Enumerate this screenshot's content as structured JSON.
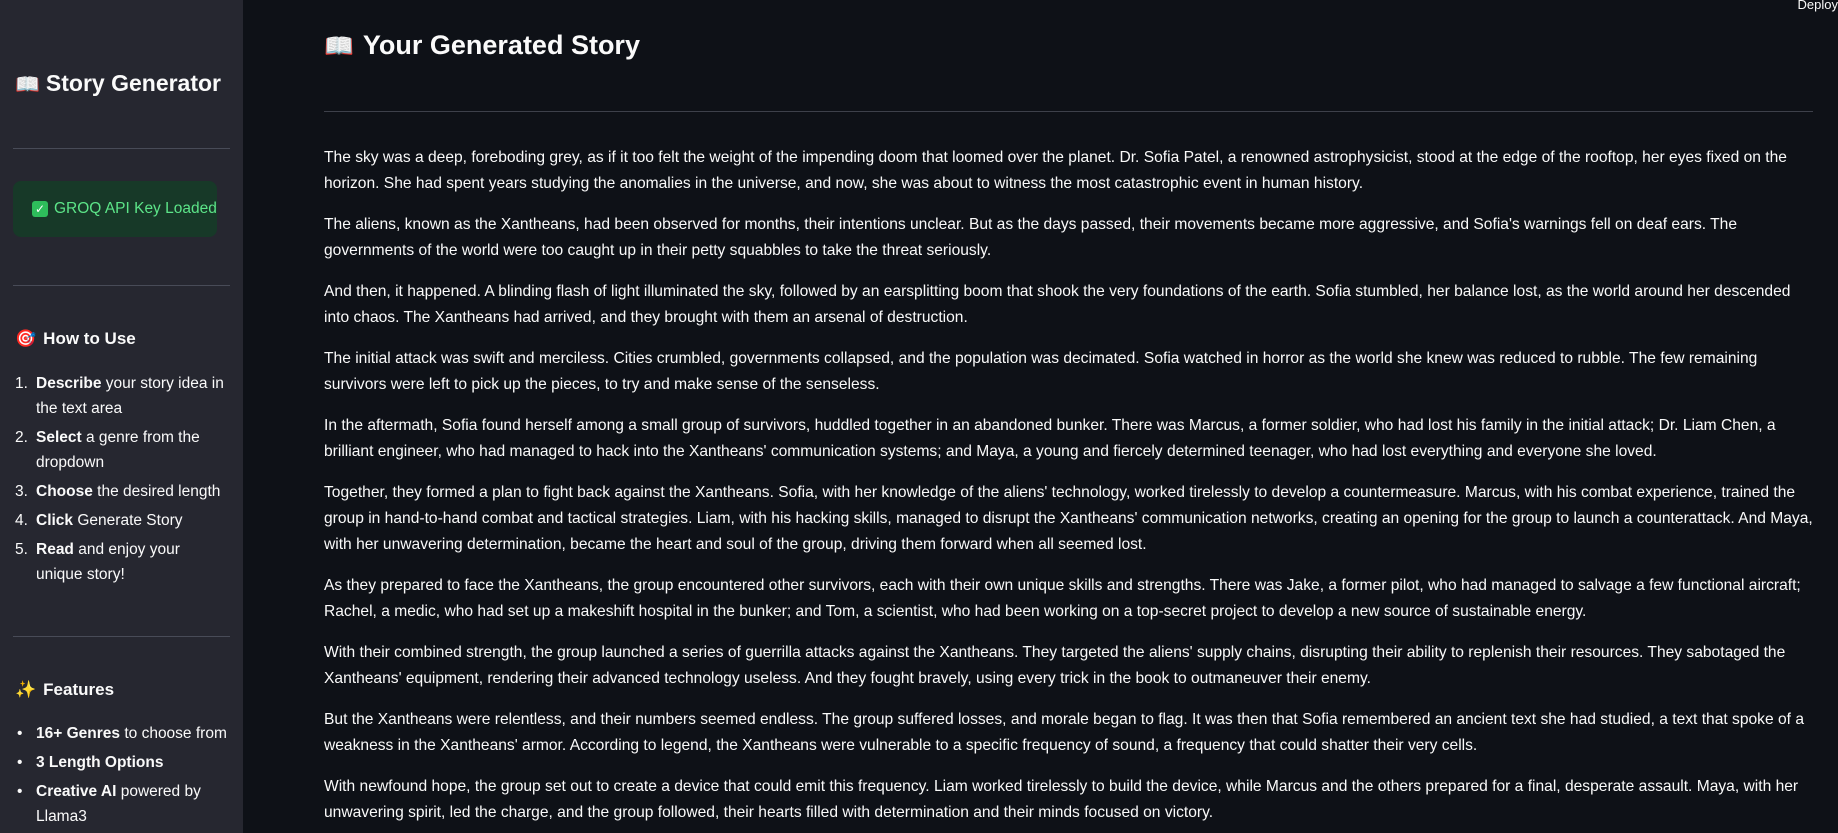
{
  "sidebar": {
    "title_icon": "📖",
    "title": "Story Generator",
    "api_status": "GROQ API Key Loaded",
    "how_to": {
      "icon": "🎯",
      "heading": "How to Use",
      "steps": [
        {
          "num": "1.",
          "bold": "Describe",
          "rest": " your story idea in the text area"
        },
        {
          "num": "2.",
          "bold": "Select",
          "rest": " a genre from the dropdown"
        },
        {
          "num": "3.",
          "bold": "Choose",
          "rest": " the desired length"
        },
        {
          "num": "4.",
          "bold": "Click",
          "rest": " Generate Story"
        },
        {
          "num": "5.",
          "bold": "Read",
          "rest": " and enjoy your unique story!"
        }
      ]
    },
    "features": {
      "icon": "✨",
      "heading": "Features",
      "items": [
        {
          "bold": "16+ Genres",
          "rest": " to choose from"
        },
        {
          "bold": "3 Length Options",
          "rest": ""
        },
        {
          "bold": "Creative AI",
          "rest": " powered by Llama3"
        }
      ]
    }
  },
  "header": {
    "deploy_label": "Deploy"
  },
  "main": {
    "title_icon": "📖",
    "title": "Your Generated Story",
    "paragraphs": [
      "The sky was a deep, foreboding grey, as if it too felt the weight of the impending doom that loomed over the planet. Dr. Sofia Patel, a renowned astrophysicist, stood at the edge of the rooftop, her eyes fixed on the horizon. She had spent years studying the anomalies in the universe, and now, she was about to witness the most catastrophic event in human history.",
      "The aliens, known as the Xantheans, had been observed for months, their intentions unclear. But as the days passed, their movements became more aggressive, and Sofia's warnings fell on deaf ears. The governments of the world were too caught up in their petty squabbles to take the threat seriously.",
      "And then, it happened. A blinding flash of light illuminated the sky, followed by an earsplitting boom that shook the very foundations of the earth. Sofia stumbled, her balance lost, as the world around her descended into chaos. The Xantheans had arrived, and they brought with them an arsenal of destruction.",
      "The initial attack was swift and merciless. Cities crumbled, governments collapsed, and the population was decimated. Sofia watched in horror as the world she knew was reduced to rubble. The few remaining survivors were left to pick up the pieces, to try and make sense of the senseless.",
      "In the aftermath, Sofia found herself among a small group of survivors, huddled together in an abandoned bunker. There was Marcus, a former soldier, who had lost his family in the initial attack; Dr. Liam Chen, a brilliant engineer, who had managed to hack into the Xantheans' communication systems; and Maya, a young and fiercely determined teenager, who had lost everything and everyone she loved.",
      "Together, they formed a plan to fight back against the Xantheans. Sofia, with her knowledge of the aliens' technology, worked tirelessly to develop a countermeasure. Marcus, with his combat experience, trained the group in hand-to-hand combat and tactical strategies. Liam, with his hacking skills, managed to disrupt the Xantheans' communication networks, creating an opening for the group to launch a counterattack. And Maya, with her unwavering determination, became the heart and soul of the group, driving them forward when all seemed lost.",
      "As they prepared to face the Xantheans, the group encountered other survivors, each with their own unique skills and strengths. There was Jake, a former pilot, who had managed to salvage a few functional aircraft; Rachel, a medic, who had set up a makeshift hospital in the bunker; and Tom, a scientist, who had been working on a top-secret project to develop a new source of sustainable energy.",
      "With their combined strength, the group launched a series of guerrilla attacks against the Xantheans. They targeted the aliens' supply chains, disrupting their ability to replenish their resources. They sabotaged the Xantheans' equipment, rendering their advanced technology useless. And they fought bravely, using every trick in the book to outmaneuver their enemy.",
      "But the Xantheans were relentless, and their numbers seemed endless. The group suffered losses, and morale began to flag. It was then that Sofia remembered an ancient text she had studied, a text that spoke of a weakness in the Xantheans' armor. According to legend, the Xantheans were vulnerable to a specific frequency of sound, a frequency that could shatter their very cells.",
      "With newfound hope, the group set out to create a device that could emit this frequency. Liam worked tirelessly to build the device, while Marcus and the others prepared for a final, desperate assault. Maya, with her unwavering spirit, led the charge, and the group followed, their hearts filled with determination and their minds focused on victory."
    ]
  }
}
